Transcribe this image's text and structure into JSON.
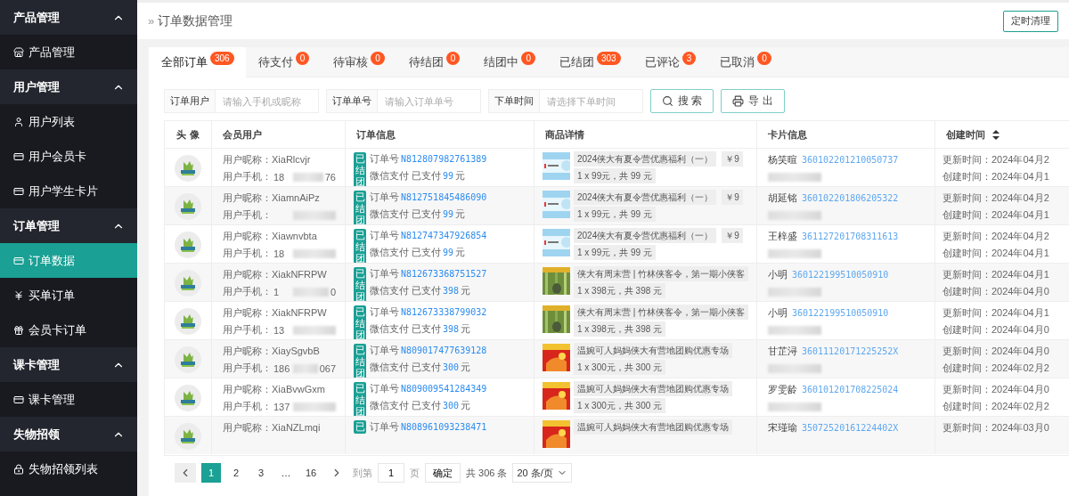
{
  "sidebar": {
    "groups": [
      {
        "title": "产品管理",
        "expanded": true,
        "items": [
          {
            "label": "产品管理",
            "selected": false
          }
        ]
      },
      {
        "title": "用户管理",
        "expanded": true,
        "items": [
          {
            "label": "用户列表",
            "selected": false
          },
          {
            "label": "用户会员卡",
            "selected": false
          },
          {
            "label": "用户学生卡片",
            "selected": false
          }
        ]
      },
      {
        "title": "订单管理",
        "expanded": true,
        "items": [
          {
            "label": "订单数据",
            "selected": true
          },
          {
            "label": "买单订单",
            "selected": false
          },
          {
            "label": "会员卡订单",
            "selected": false
          }
        ]
      },
      {
        "title": "课卡管理",
        "expanded": true,
        "items": [
          {
            "label": "课卡管理",
            "selected": false
          }
        ]
      },
      {
        "title": "失物招领",
        "expanded": true,
        "items": [
          {
            "label": "失物招领列表",
            "selected": false
          }
        ]
      }
    ]
  },
  "header": {
    "breadcrumb_mark": "»",
    "title": "订单数据管理",
    "action": "定时清理"
  },
  "tabs": [
    {
      "label": "全部订单",
      "count": "306",
      "selected": true
    },
    {
      "label": "待支付",
      "count": "0",
      "selected": false
    },
    {
      "label": "待审核",
      "count": "0",
      "selected": false
    },
    {
      "label": "待结团",
      "count": "0",
      "selected": false
    },
    {
      "label": "结团中",
      "count": "0",
      "selected": false
    },
    {
      "label": "已结团",
      "count": "303",
      "selected": false
    },
    {
      "label": "已评论",
      "count": "3",
      "selected": false
    },
    {
      "label": "已取消",
      "count": "0",
      "selected": false
    }
  ],
  "filters": [
    {
      "label": "订单用户",
      "placeholder": "请输入手机或昵称"
    },
    {
      "label": "订单单号",
      "placeholder": "请输入订单单号"
    },
    {
      "label": "下单时间",
      "placeholder": "请选择下单时间"
    }
  ],
  "buttons": [
    {
      "label": "搜 索"
    },
    {
      "label": "导 出"
    }
  ],
  "table": {
    "columns": [
      {
        "label": "头 像"
      },
      {
        "label": "会员用户"
      },
      {
        "label": "订单信息"
      },
      {
        "label": "商品详情"
      },
      {
        "label": "卡片信息"
      },
      {
        "label": "创建时间"
      }
    ],
    "rows": [
      {
        "nickname": "用户昵称：XiaRlcvjr",
        "phone_label": "用户手机：",
        "phone_prefix": "18",
        "phone_suffix": "76",
        "status": "已结团",
        "order_label": "订单号",
        "order_no": "N812807982761389",
        "pay": "微信支付 已支付",
        "amount": "99",
        "unit": "元",
        "product": "2024侠大有夏令营优惠福利（一）",
        "price": "￥9",
        "qty": "1 x 99元，共 99 元",
        "card_name": "杨笑暄",
        "card_id": "360102201210050737",
        "updated": "更新时间：2024年04月2",
        "created": "创建时间：2024年04月1"
      },
      {
        "nickname": "用户昵称：XiamnAiPz",
        "phone_label": "用户手机：",
        "status": "已结团",
        "order_label": "订单号",
        "order_no": "N812751845486090",
        "pay": "微信支付 已支付",
        "amount": "99",
        "unit": "元",
        "product": "2024侠大有夏令营优惠福利（一）",
        "price": "￥9",
        "qty": "1 x 99元，共 99 元",
        "card_name": "胡延铭",
        "card_id": "360102201806205322",
        "updated": "更新时间：2024年04月2",
        "created": "创建时间：2024年04月1"
      },
      {
        "nickname": "用户昵称：Xiawnvbta",
        "phone_label": "用户手机：",
        "phone_prefix": "18",
        "status": "已结团",
        "order_label": "订单号",
        "order_no": "N812747347926854",
        "pay": "微信支付 已支付",
        "amount": "99",
        "unit": "元",
        "product": "2024侠大有夏令营优惠福利（一）",
        "price": "￥9",
        "qty": "1 x 99元，共 99 元",
        "card_name": "王梓盛",
        "card_id": "361127201708311613",
        "updated": "更新时间：2024年04月2",
        "created": "创建时间：2024年04月1"
      },
      {
        "nickname": "用户昵称：XiakNFRPW",
        "phone_label": "用户手机：",
        "phone_prefix": "1",
        "phone_suffix": "0",
        "status": "已结团",
        "order_label": "订单号",
        "order_no": "N812673368751527",
        "pay": "微信支付 已支付",
        "amount": "398",
        "unit": "元",
        "product": "侠大有周末营 | 竹林侠客令，第一期小侠客",
        "qty": "1 x 398元，共 398 元",
        "card_name": "小明",
        "card_id": "360122199510050910",
        "updated": "更新时间：2024年04月1",
        "created": "创建时间：2024年04月0"
      },
      {
        "nickname": "用户昵称：XiakNFRPW",
        "phone_label": "用户手机：",
        "phone_prefix": "13",
        "status": "已结团",
        "order_label": "订单号",
        "order_no": "N812673338799032",
        "pay": "微信支付 已支付",
        "amount": "398",
        "unit": "元",
        "product": "侠大有周末营 | 竹林侠客令，第一期小侠客",
        "qty": "1 x 398元，共 398 元",
        "card_name": "小明",
        "card_id": "360122199510050910",
        "updated": "更新时间：2024年04月1",
        "created": "创建时间：2024年04月0"
      },
      {
        "nickname": "用户昵称：XiaySgvbB",
        "phone_label": "用户手机：",
        "phone_prefix": "186",
        "phone_suffix": "067",
        "status": "已结团",
        "order_label": "订单号",
        "order_no": "N809017477639128",
        "pay": "微信支付 已支付",
        "amount": "300",
        "unit": "元",
        "product": "温婉可人妈妈侠大有营地团购优惠专场",
        "qty": "1 x 300元，共 300 元",
        "card_name": "甘芷浔",
        "card_id": "36011120171225252X",
        "updated": "更新时间：2024年04月0",
        "created": "创建时间：2024年02月2"
      },
      {
        "nickname": "用户昵称：XiaBvwGxm",
        "phone_label": "用户手机：",
        "phone_prefix": "137",
        "status": "已结团",
        "order_label": "订单号",
        "order_no": "N809009541284349",
        "pay": "微信支付 已支付",
        "amount": "300",
        "unit": "元",
        "product": "温婉可人妈妈侠大有营地团购优惠专场",
        "qty": "1 x 300元，共 300 元",
        "card_name": "罗雯龄",
        "card_id": "360101201708225024",
        "updated": "更新时间：2024年04月0",
        "created": "创建时间：2024年02月2"
      },
      {
        "nickname": "用户昵称：XiaNZLmqi",
        "status": "已",
        "order_label": "订单号",
        "order_no": "N808961093238471",
        "product": "温婉可人妈妈侠大有营地团购优惠专场",
        "card_name": "宋瑾瑜",
        "card_id": "35072520161224402X",
        "updated": "更新时间：2024年03月0"
      }
    ]
  },
  "pagination": {
    "pages": [
      {
        "label": "1",
        "selected": true
      },
      {
        "label": "2",
        "selected": false
      },
      {
        "label": "3",
        "selected": false
      },
      {
        "label": "…",
        "selected": false
      },
      {
        "label": "16",
        "selected": false
      }
    ],
    "goto_label": "到第",
    "goto_value": "1",
    "page_unit": "页",
    "confirm": "确定",
    "total": "共 306 条",
    "page_size": "20 条/页"
  }
}
